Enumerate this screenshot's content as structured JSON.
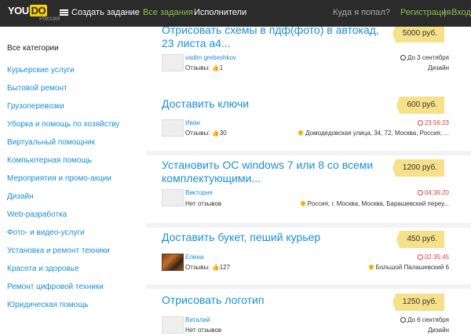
{
  "topbar": {
    "logo_you": "YOU",
    "logo_do": "DO",
    "logo_sub": "Россия",
    "create_label": "Создать задание",
    "all_tasks": "Все задания",
    "performers": "Исполнители",
    "where": "Куда я попал?",
    "register": "Регистрация",
    "sep": "|",
    "login": "Вход"
  },
  "sidebar": {
    "title": "Все категории",
    "items": [
      "Курьерские услуги",
      "Бытовой ремонт",
      "Грузоперевозки",
      "Уборка и помощь по хозяйству",
      "Виртуальный помощник",
      "Компьютерная помощь",
      "Мероприятия и промо-акции",
      "Дизайн",
      "Web-разработка",
      "Фото- и видео-услуги",
      "Установка и ремонт техники",
      "Красота и здоровье",
      "Ремонт цифровой техники",
      "Юридическая помощь"
    ]
  },
  "tasks": [
    {
      "title": "Отрисовать схемы в пдф(фото) в автокад, 23 листа а4...",
      "price": "5000 руб.",
      "user": "vadim grebeshkov",
      "reviews_label": "Отзывы:",
      "reviews_count": "1",
      "meta_top": "До 3 сентября",
      "meta_bottom": "Дизайн"
    },
    {
      "title": "Доставить ключи",
      "price": "600 руб.",
      "user": "Иван",
      "reviews_label": "Отзывы:",
      "reviews_count": "30",
      "meta_top": "23:56:23",
      "meta_bottom": "Домодедовская улица, 34, 72, Москва, Россия, ..."
    },
    {
      "title": "Установить ОС windows 7 или 8 со всеми комплектующими...",
      "price": "1200 руб.",
      "user": "Виктория",
      "reviews_label": "Нет отзывов",
      "reviews_count": "",
      "meta_top": "04:36:20",
      "meta_bottom": "Россия, г. Москва, Москва, Барашевский переу..."
    },
    {
      "title": "Доставить букет, пеший курьер",
      "price": "450 руб.",
      "user": "Елена",
      "reviews_label": "Отзывы:",
      "reviews_count": "127",
      "meta_top": "02:35:45",
      "meta_bottom": "Большой Палашевский 6"
    },
    {
      "title": "Отрисовать логотип",
      "price": "1250 руб.",
      "user": "Виталий",
      "reviews_label": "Нет отзывов",
      "reviews_count": "",
      "meta_top": "До 6 сентября",
      "meta_bottom": "Дизайн"
    }
  ]
}
